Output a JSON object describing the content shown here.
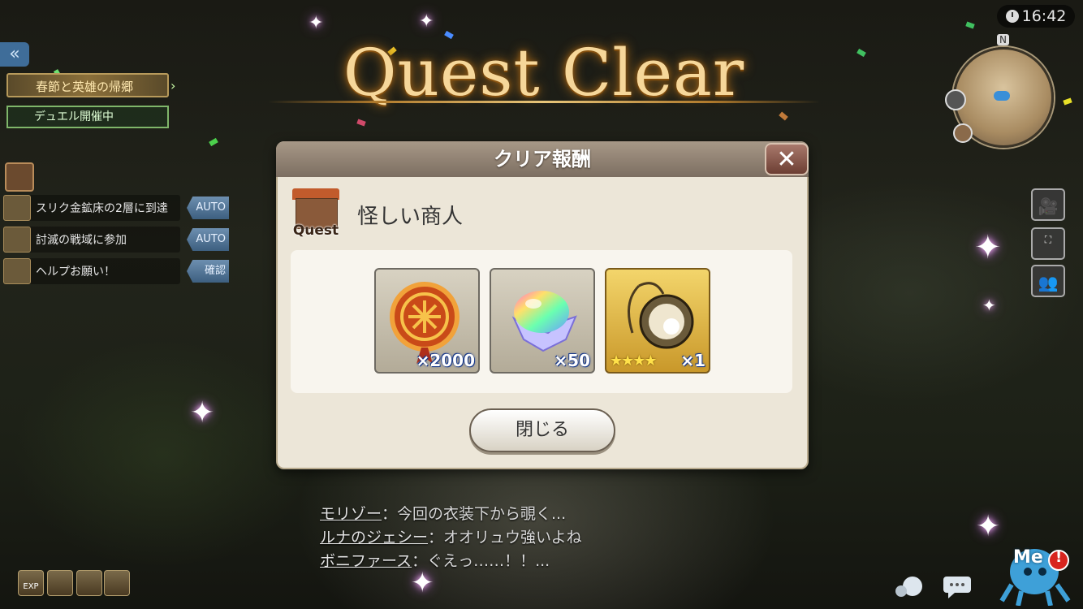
{
  "header": {
    "title": "Quest Clear",
    "clock": "16:42",
    "compass": "N"
  },
  "left_panel": {
    "event_banner": "春節と英雄の帰郷",
    "duel_banner": "デュエル開催中",
    "quests": [
      {
        "label": "スリク金鉱床の2層に到達",
        "tag": "AUTO"
      },
      {
        "label": "討滅の戦域に参加",
        "tag": "AUTO"
      },
      {
        "label": "ヘルプお願い！",
        "tag": "確認"
      }
    ]
  },
  "dialog": {
    "title": "クリア報酬",
    "close_symbol": "✕",
    "quest_badge": "Quest",
    "npc_name": "怪しい商人",
    "rewards": [
      {
        "icon": "medal-coin-icon",
        "count": "×2000"
      },
      {
        "icon": "rainbow-crystal-icon",
        "count": "×50"
      },
      {
        "icon": "gold-ornament-icon",
        "stars": "★★★★",
        "count": "×1"
      }
    ],
    "close_button": "閉じる"
  },
  "chat": [
    {
      "who": "モリゾー",
      "text": "：今回の衣装下から覗く..."
    },
    {
      "who": "ルナのジェシー",
      "text": "：オオリュウ強いよね"
    },
    {
      "who": "ボニファース",
      "text": "：ぐえっ……！！..."
    }
  ],
  "bottom_bar": {
    "exp_label": "EXP",
    "me_label": "Me",
    "alert": "!"
  },
  "colors": {
    "title_gold": "#f6d79a",
    "dialog_bg": "#ece6d8",
    "header_brown": "#8c7d70",
    "auto_blue": "#4f7aa3"
  }
}
